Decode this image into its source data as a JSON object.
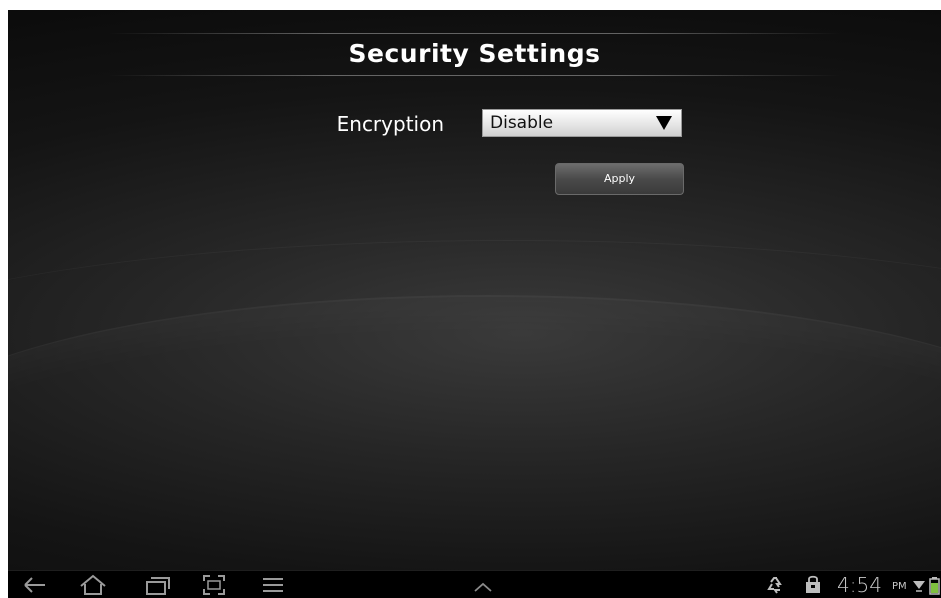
{
  "page": {
    "title": "Security Settings"
  },
  "form": {
    "encryption_label": "Encryption",
    "encryption_value": "Disable",
    "apply_label": "Apply"
  },
  "navbar": {
    "icons": [
      "back-arrow-icon",
      "home-icon",
      "recent-apps-icon",
      "screenshot-icon",
      "menu-icon",
      "chevron-up-icon"
    ]
  },
  "statusbar": {
    "time": "4:54",
    "ampm": "PM",
    "icons": [
      "recycle-icon",
      "shopping-bag-icon",
      "wifi-icon",
      "battery-icon"
    ]
  },
  "colors": {
    "background": "#1a1a1a",
    "text": "#ffffff",
    "navbar": "#000000"
  }
}
